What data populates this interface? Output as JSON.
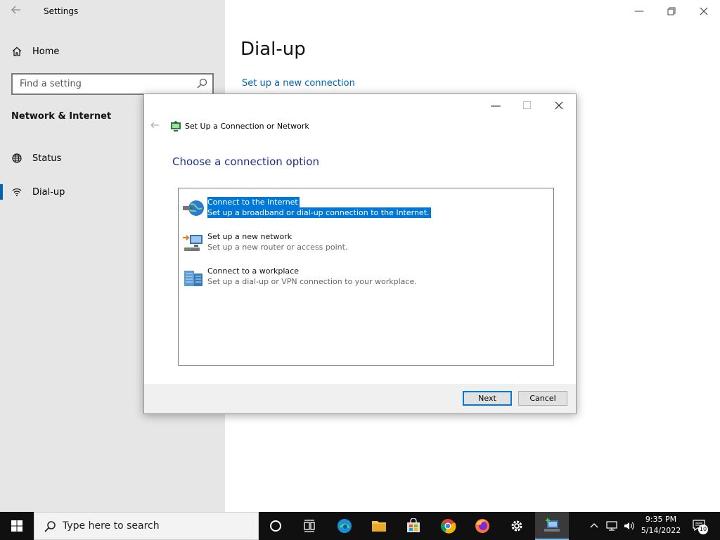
{
  "settings": {
    "window_title": "Settings",
    "home_label": "Home",
    "search_placeholder": "Find a setting",
    "section_title": "Network & Internet",
    "nav": [
      {
        "label": "Status",
        "icon": "globe-icon"
      },
      {
        "label": "Dial-up",
        "icon": "dialup-icon",
        "selected": true
      }
    ],
    "page_title": "Dial-up",
    "link_new_connection": "Set up a new connection",
    "accent_color": "#0063b1"
  },
  "dialog": {
    "title": "Set Up a Connection or Network",
    "heading": "Choose a connection option",
    "options": [
      {
        "title": "Connect to the Internet",
        "description": "Set up a broadband or dial-up connection to the Internet.",
        "icon": "internet-globe-icon",
        "selected": true
      },
      {
        "title": "Set up a new network",
        "description": "Set up a new router or access point.",
        "icon": "new-network-icon",
        "selected": false
      },
      {
        "title": "Connect to a workplace",
        "description": "Set up a dial-up or VPN connection to your workplace.",
        "icon": "workplace-icon",
        "selected": false
      }
    ],
    "next_label": "Next",
    "cancel_label": "Cancel",
    "selection_color": "#0078d7"
  },
  "taskbar": {
    "search_placeholder": "Type here to search",
    "apps": [
      "cortana-icon",
      "task-view-icon",
      "edge-icon",
      "file-explorer-icon",
      "store-icon",
      "chrome-icon",
      "firefox-icon",
      "settings-gear-icon",
      "network-setup-icon"
    ],
    "time": "9:35 PM",
    "date": "5/14/2022",
    "notification_count": "10"
  }
}
